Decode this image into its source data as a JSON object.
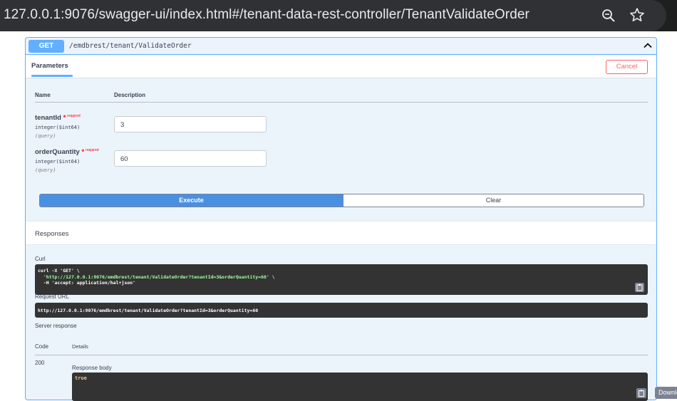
{
  "browser": {
    "url": "127.0.0.1:9076/swagger-ui/index.html#/tenant-data-rest-controller/TenantValidateOrder",
    "zoom_icon": "zoom-icon",
    "bookmark_icon": "star-icon"
  },
  "operation": {
    "method": "GET",
    "path": "/emdbrest/tenant/ValidateOrder",
    "collapse_icon": "chevron-up-icon"
  },
  "parameters": {
    "tab_label": "Parameters",
    "cancel_label": "Cancel",
    "col_name": "Name",
    "col_description": "Description",
    "items": [
      {
        "name": "tenantId",
        "required_star": "*",
        "required_label": "required",
        "type": "integer($int64)",
        "in": "(query)",
        "value": "3"
      },
      {
        "name": "orderQuantity",
        "required_star": "*",
        "required_label": "required",
        "type": "integer($int64)",
        "in": "(query)",
        "value": "60"
      }
    ],
    "execute_label": "Execute",
    "clear_label": "Clear"
  },
  "responses": {
    "title": "Responses",
    "curl_label": "Curl",
    "curl_lines": [
      "curl -X 'GET' \\",
      "  'http://127.0.0.1:9076/emdbrest/tenant/ValidateOrder?tenantId=3&orderQuantity=60' \\",
      "  -H 'accept: application/hal+json'"
    ],
    "request_url_label": "Request URL",
    "request_url": "http://127.0.0.1:9076/emdbrest/tenant/ValidateOrder?tenantId=3&orderQuantity=60",
    "server_response_label": "Server response",
    "col_code": "Code",
    "col_details": "Details",
    "code": "200",
    "response_body_label": "Response body",
    "response_body": "true",
    "download_label": "Download",
    "copy_icon": "clipboard-icon"
  },
  "colors": {
    "get_blue": "#61affe",
    "execute_blue": "#4990e2",
    "cancel_red": "#ff6060",
    "code_bg": "#333333"
  }
}
